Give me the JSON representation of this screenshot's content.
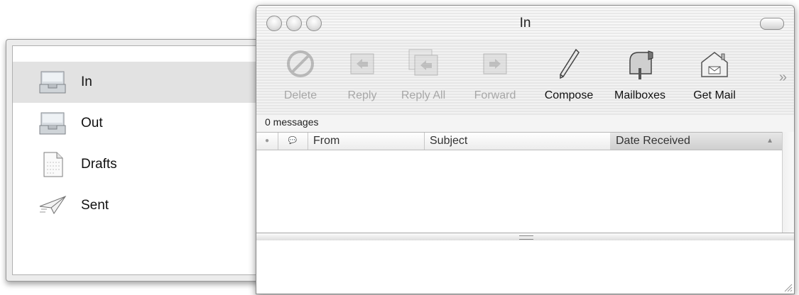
{
  "drawer": {
    "mailboxes": [
      {
        "label": "In",
        "icon": "inbox-tray-icon",
        "selected": true
      },
      {
        "label": "Out",
        "icon": "outbox-tray-icon",
        "selected": false
      },
      {
        "label": "Drafts",
        "icon": "draft-document-icon",
        "selected": false
      },
      {
        "label": "Sent",
        "icon": "paper-plane-icon",
        "selected": false
      }
    ]
  },
  "window": {
    "title": "In",
    "toolbar": [
      {
        "label": "Delete",
        "icon": "delete-icon",
        "enabled": false
      },
      {
        "label": "Reply",
        "icon": "reply-icon",
        "enabled": false
      },
      {
        "label": "Reply All",
        "icon": "reply-all-icon",
        "enabled": false
      },
      {
        "label": "Forward",
        "icon": "forward-icon",
        "enabled": false
      },
      {
        "label": "Compose",
        "icon": "pen-icon",
        "enabled": true
      },
      {
        "label": "Mailboxes",
        "icon": "mailbox-icon",
        "enabled": true
      },
      {
        "label": "Get Mail",
        "icon": "get-mail-icon",
        "enabled": true
      }
    ],
    "overflow_label": "»",
    "status_text": "0 messages",
    "columns": {
      "status": "●",
      "flag": "💬",
      "from": "From",
      "subject": "Subject",
      "date_received": "Date Received",
      "sort_indicator": "▲"
    }
  }
}
